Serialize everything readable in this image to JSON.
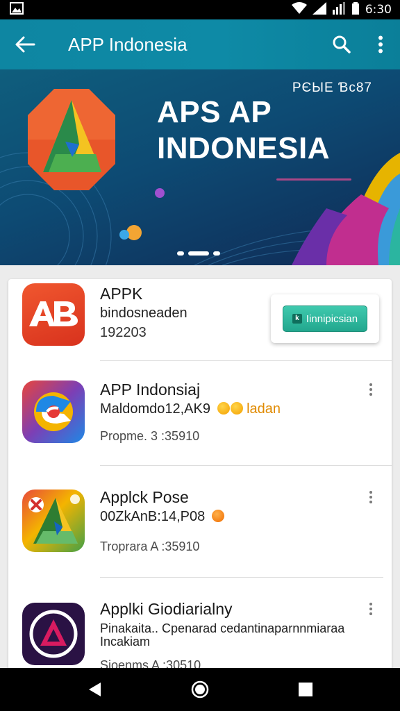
{
  "status_bar": {
    "time": "6:30"
  },
  "app_bar": {
    "title": "APP Indonesia"
  },
  "banner": {
    "code": "PЄЫЕ Ɓc87",
    "title_line1": "APS AP",
    "title_line2": "INDONESIA",
    "slide_count": 3,
    "active_slide": 1
  },
  "list": {
    "items": [
      {
        "name": "APPK",
        "desc": "bindosneaden",
        "meta": "192203",
        "icon": "ab-logo-icon",
        "action_label": "Iinnipicsian"
      },
      {
        "name": "APP Indonsiaj",
        "desc": "Maldomdo12,AK9",
        "desc_extra": "ladan",
        "meta": "Propme. 3 :35910",
        "icon": "swirl-app-icon"
      },
      {
        "name": "Applck Pose",
        "desc": "00ZkAnB:14,P08",
        "meta": "Troprara A :35910",
        "icon": "triangle-app-icon"
      },
      {
        "name": "Applki Giodiarialny",
        "desc": "Pinakaita.. Cpenarad cedantinaparnnmiaraa Incakiam",
        "meta": "Sioenms A :30510",
        "icon": "circle-a-app-icon"
      }
    ]
  },
  "colors": {
    "app_bar": "#0e86a2",
    "install_button": "#2bb89c",
    "nav_bar": "#000000"
  },
  "nav": {
    "back": "back-triangle-icon",
    "home": "home-circle-icon",
    "recents": "recents-square-icon"
  }
}
